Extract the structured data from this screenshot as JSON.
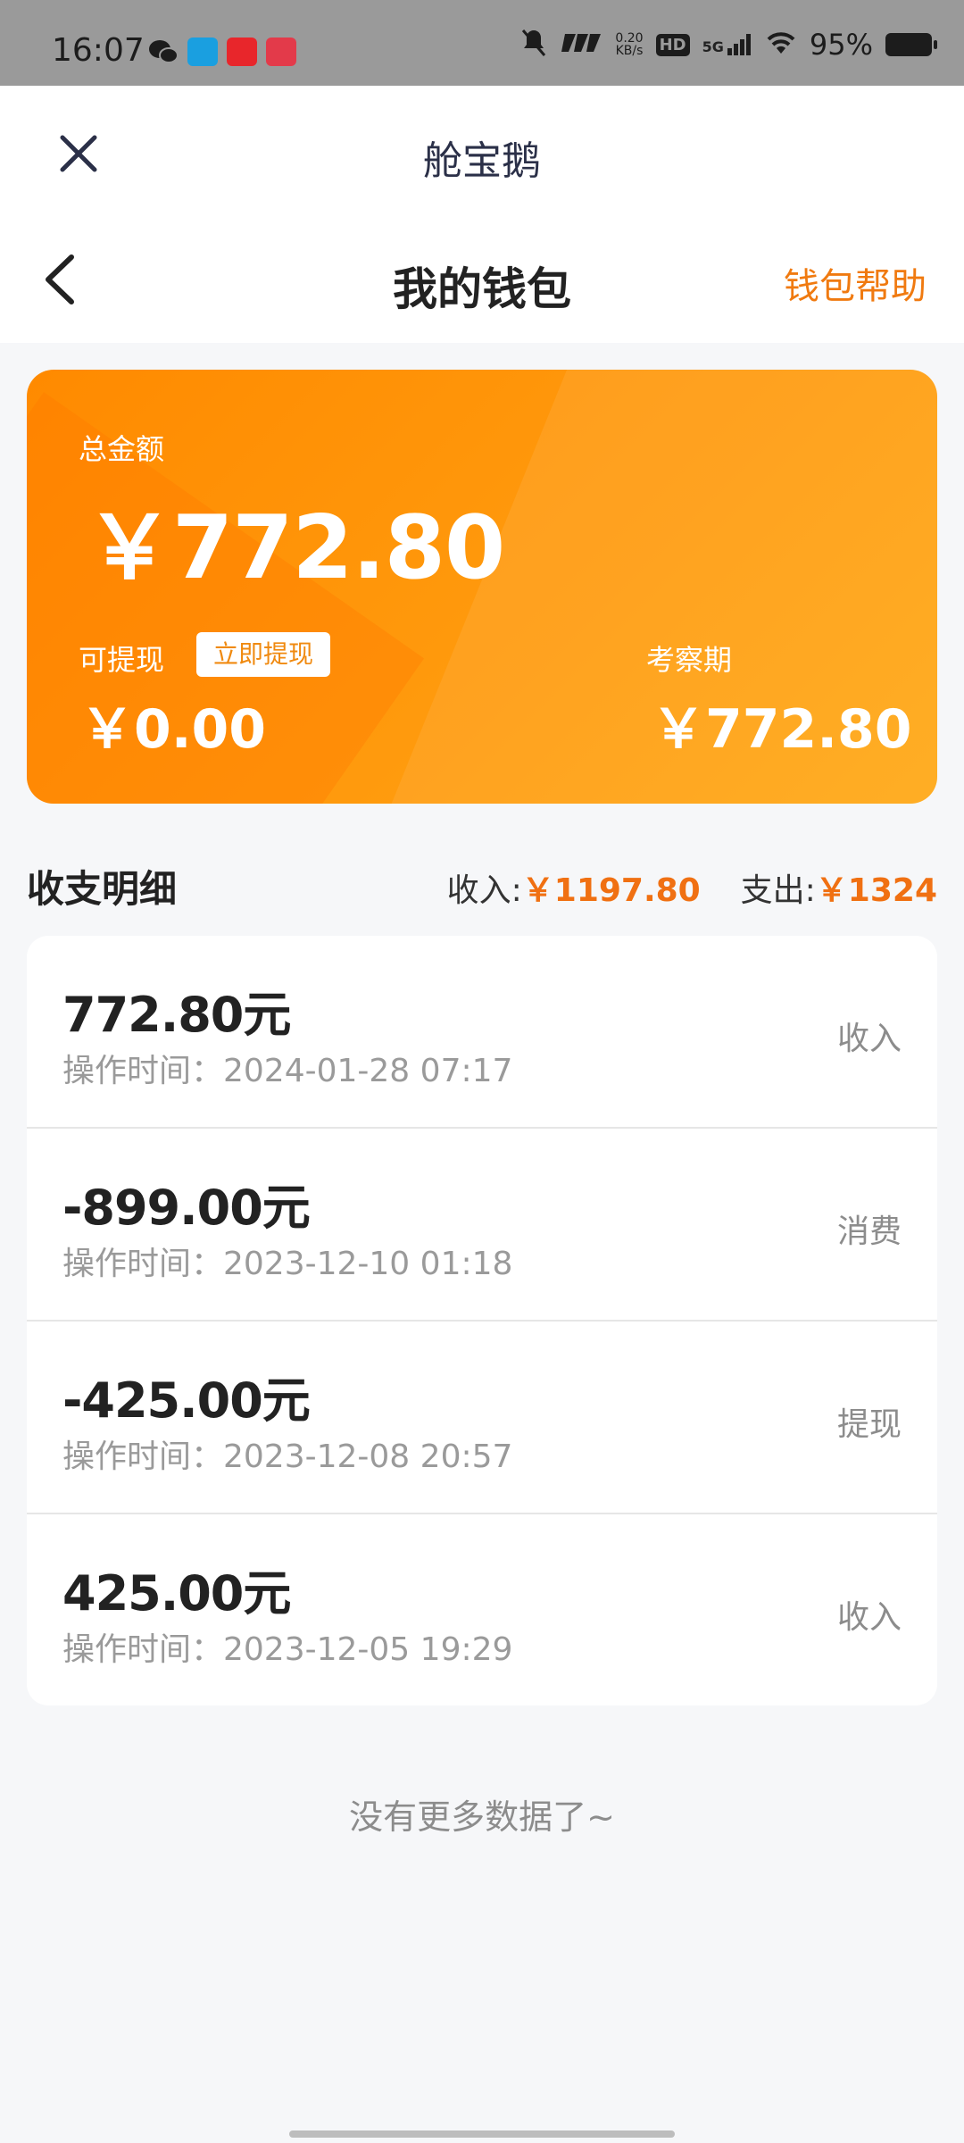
{
  "status_bar": {
    "time": "16:07",
    "net_speed_value": "0.20",
    "net_speed_unit": "KB/s",
    "network": "5G",
    "hd_label": "HD",
    "battery": "95%"
  },
  "header": {
    "mini_program_name": "舱宝鹅",
    "title": "我的钱包",
    "help_label": "钱包帮助"
  },
  "wallet": {
    "total_label": "总金额",
    "total_amount": "￥772.80",
    "withdrawable_label": "可提现",
    "withdraw_button": "立即提现",
    "withdrawable_amount": "￥0.00",
    "review_label": "考察期",
    "review_amount": "￥772.80"
  },
  "summary": {
    "title": "收支明细",
    "income_label": "收入:",
    "income_amount": "￥1197.80",
    "expense_label": "支出:",
    "expense_amount": "￥1324"
  },
  "transactions": [
    {
      "amount": "772.80元",
      "time": "操作时间：2024-01-28 07:17",
      "type": "收入"
    },
    {
      "amount": "-899.00元",
      "time": "操作时间：2023-12-10 01:18",
      "type": "消费"
    },
    {
      "amount": "-425.00元",
      "time": "操作时间：2023-12-08 20:57",
      "type": "提现"
    },
    {
      "amount": "425.00元",
      "time": "操作时间：2023-12-05 19:29",
      "type": "收入"
    }
  ],
  "footer": {
    "no_more": "没有更多数据了~"
  },
  "colors": {
    "accent": "#f07a10",
    "card_start": "#ff8a00",
    "card_end": "#ffa712"
  }
}
